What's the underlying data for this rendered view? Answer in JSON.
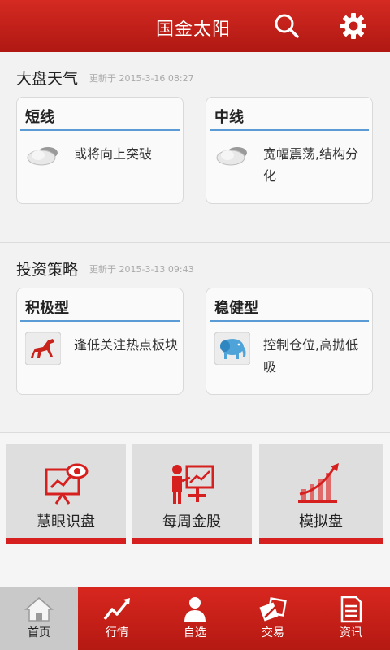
{
  "header": {
    "title": "国金太阳"
  },
  "weather": {
    "title": "大盘天气",
    "updated": "更新于 2015-3-16 08:27",
    "cards": [
      {
        "title": "短线",
        "text": "或将向上突破",
        "icon": "cloud-icon"
      },
      {
        "title": "中线",
        "text": "宽幅震荡,结构分化",
        "icon": "cloud-icon"
      }
    ]
  },
  "strategy": {
    "title": "投资策略",
    "updated": "更新于 2015-3-13 09:43",
    "cards": [
      {
        "title": "积极型",
        "text": "逢低关注热点板块",
        "icon": "horse-icon"
      },
      {
        "title": "稳健型",
        "text": "控制仓位,高抛低吸",
        "icon": "elephant-icon"
      }
    ]
  },
  "tiles": [
    {
      "label": "慧眼识盘",
      "icon": "eye-chart-icon"
    },
    {
      "label": "每周金股",
      "icon": "presenter-icon"
    },
    {
      "label": "模拟盘",
      "icon": "bar-growth-icon"
    }
  ],
  "nav": [
    {
      "label": "首页",
      "icon": "home-icon",
      "active": true
    },
    {
      "label": "行情",
      "icon": "trend-icon"
    },
    {
      "label": "自选",
      "icon": "person-icon"
    },
    {
      "label": "交易",
      "icon": "exchange-icon"
    },
    {
      "label": "资讯",
      "icon": "document-icon"
    }
  ],
  "colors": {
    "brand_red": "#c41f18",
    "accent_blue": "#5b9bd5"
  }
}
